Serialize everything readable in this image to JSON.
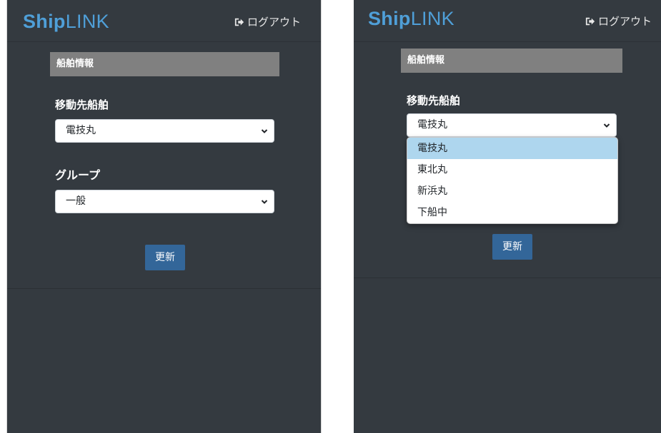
{
  "app": {
    "logo_bold": "Ship",
    "logo_rest": "LINK",
    "logout_label": "ログアウト"
  },
  "form": {
    "section_title": "船舶情報",
    "ship_label": "移動先船舶",
    "ship_selected": "電技丸",
    "group_label": "グループ",
    "group_selected": "一般",
    "update_button": "更新"
  },
  "ship_options": [
    "電技丸",
    "東北丸",
    "新浜丸",
    "下船中"
  ],
  "colors": {
    "panel_bg": "#343a40",
    "brand": "#4f9fd8",
    "header_bar": "#808080",
    "button": "#336699",
    "option_highlight": "#aed6ee"
  }
}
